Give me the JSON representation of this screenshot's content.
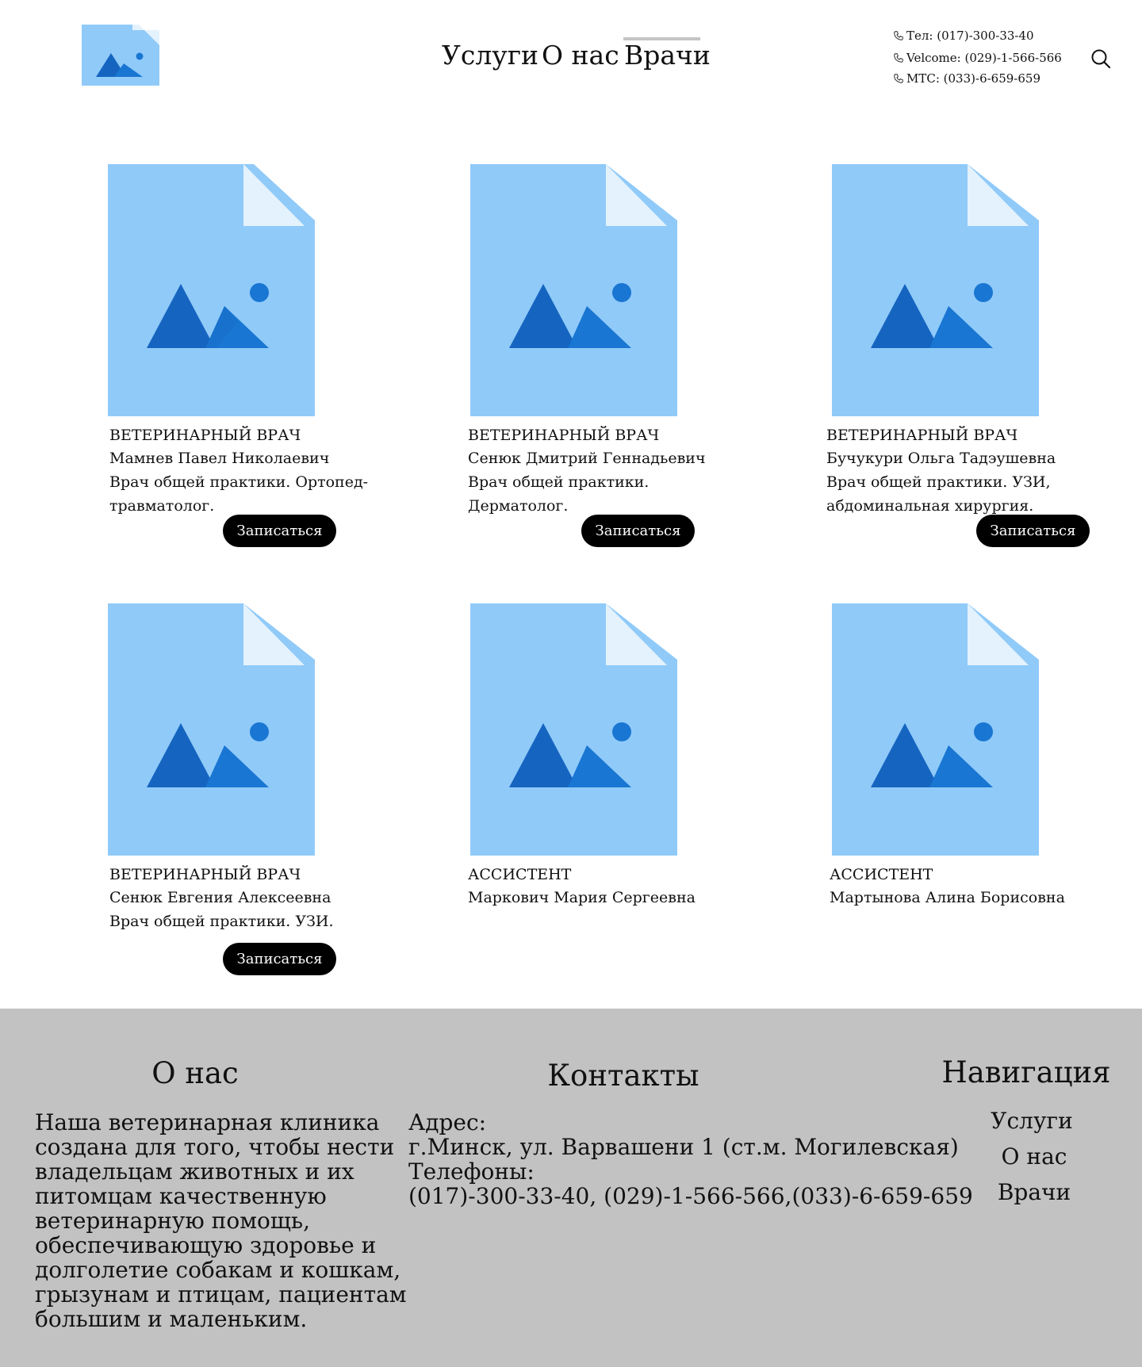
{
  "header": {
    "nav": [
      {
        "label": "Услуги"
      },
      {
        "label": "О нас"
      },
      {
        "label": "Врачи",
        "active": true
      }
    ],
    "phones": [
      "Тел: (017)-300-33-40",
      "Velcome: (029)-1-566-566",
      "МТС: (033)-6-659-659"
    ],
    "icons": {
      "logo": "image-placeholder-icon",
      "phone": "phone-icon",
      "search": "search-icon"
    }
  },
  "doctors": [
    {
      "role": "ВЕТЕРИНАРНЫЙ ВРАЧ",
      "name": "Мамнев Павел Николаевич",
      "desc": [
        "Врач общей практики. Ортопед-",
        "травматолог."
      ],
      "button": "Записаться"
    },
    {
      "role": "ВЕТЕРИНАРНЫЙ ВРАЧ",
      "name": "Сенюк Дмитрий Геннадьевич",
      "desc": [
        "Врач общей практики.",
        "Дерматолог."
      ],
      "button": "Записаться"
    },
    {
      "role": "ВЕТЕРИНАРНЫЙ ВРАЧ",
      "name": "Бучукури Ольга Тадэушевна",
      "desc": [
        "Врач общей практики. УЗИ,",
        "абдоминальная хирургия."
      ],
      "button": "Записаться"
    },
    {
      "role": "ВЕТЕРИНАРНЫЙ ВРАЧ",
      "name": "Сенюк Евгения Алексеевна",
      "desc": [
        "Врач общей практики. УЗИ."
      ],
      "button": "Записаться"
    },
    {
      "role": "АССИСТЕНТ",
      "name": "Маркович Мария Сергеевна",
      "desc": []
    },
    {
      "role": "АССИСТЕНТ",
      "name": "Мартынова Алина Борисовна",
      "desc": []
    }
  ],
  "footer": {
    "about": {
      "title": "О нас",
      "lines": [
        "Наша ветеринарная клиника",
        "создана для того, чтобы нести",
        "владельцам животных и их",
        "питомцам качественную",
        "ветеринарную помощь,",
        "обеспечивающую здоровье и",
        "долголетие собакам и кошкам,",
        "грызунам и птицам, пациентам",
        "большим и маленьким."
      ]
    },
    "contacts": {
      "title": "Контакты",
      "lines": [
        "Адрес:",
        "г.Минск, ул. Варвашени 1 (ст.м. Могилевская)",
        "Телефоны:",
        "(017)-300-33-40, (029)-1-566-566,(033)-6-659-659"
      ]
    },
    "navigation": {
      "title": "Навигация",
      "items": [
        "Услуги",
        "О нас",
        "Врачи"
      ]
    }
  },
  "colors": {
    "image_bg": "#90caf9",
    "image_fold": "#e3f2fd",
    "mountain_dark": "#1565c0",
    "mountain_light": "#1976d2",
    "footer_bg": "#c2c2c2",
    "nav_underline": "#c4c4c4",
    "button_bg": "#000000"
  }
}
